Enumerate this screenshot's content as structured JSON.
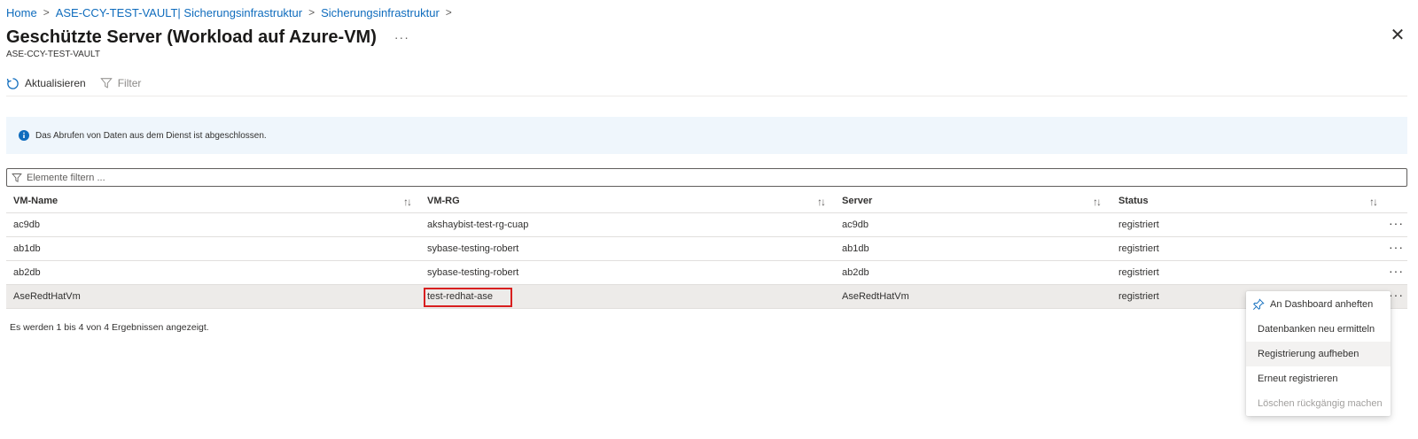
{
  "breadcrumb": {
    "items": [
      "Home",
      "ASE-CCY-TEST-VAULT| Sicherungsinfrastruktur",
      "Sicherungsinfrastruktur"
    ]
  },
  "header": {
    "title": "Geschützte Server (Workload auf Azure-VM)",
    "more": "···",
    "subtitle": "ASE-CCY-TEST-VAULT",
    "close": "✕"
  },
  "toolbar": {
    "refresh_label": "Aktualisieren",
    "filter_label": "Filter"
  },
  "info": {
    "message": "Das Abrufen von Daten aus dem Dienst ist abgeschlossen."
  },
  "search": {
    "placeholder": "Elemente filtern ..."
  },
  "table": {
    "columns": [
      "VM-Name",
      "VM-RG",
      "Server",
      "Status"
    ],
    "sort_icon": "↑↓",
    "more": "···",
    "rows": [
      {
        "vm_name": "ac9db",
        "vm_rg": "akshaybist-test-rg-cuap",
        "server": "ac9db",
        "status": "registriert"
      },
      {
        "vm_name": "ab1db",
        "vm_rg": "sybase-testing-robert",
        "server": "ab1db",
        "status": "registriert"
      },
      {
        "vm_name": "ab2db",
        "vm_rg": "sybase-testing-robert",
        "server": "ab2db",
        "status": "registriert"
      },
      {
        "vm_name": "AseRedtHatVm",
        "vm_rg": "test-redhat-ase",
        "server": "AseRedtHatVm",
        "status": "registriert"
      }
    ]
  },
  "footer": {
    "result_text": "Es werden 1 bis 4 von 4 Ergebnissen angezeigt."
  },
  "context_menu": {
    "items": [
      {
        "label": "An Dashboard anheften",
        "icon": "pin-icon"
      },
      {
        "label": "Datenbanken neu ermitteln"
      },
      {
        "label": "Registrierung aufheben",
        "state": "hovered"
      },
      {
        "label": "Erneut registrieren"
      },
      {
        "label": "Löschen rückgängig machen",
        "state": "disabled"
      }
    ]
  },
  "colors": {
    "link": "#0f6cbd",
    "info_background": "#eff6fc",
    "info_icon": "#0f6cbd",
    "highlight_box": "#d81f1f",
    "selected_row": "#edebe9"
  }
}
